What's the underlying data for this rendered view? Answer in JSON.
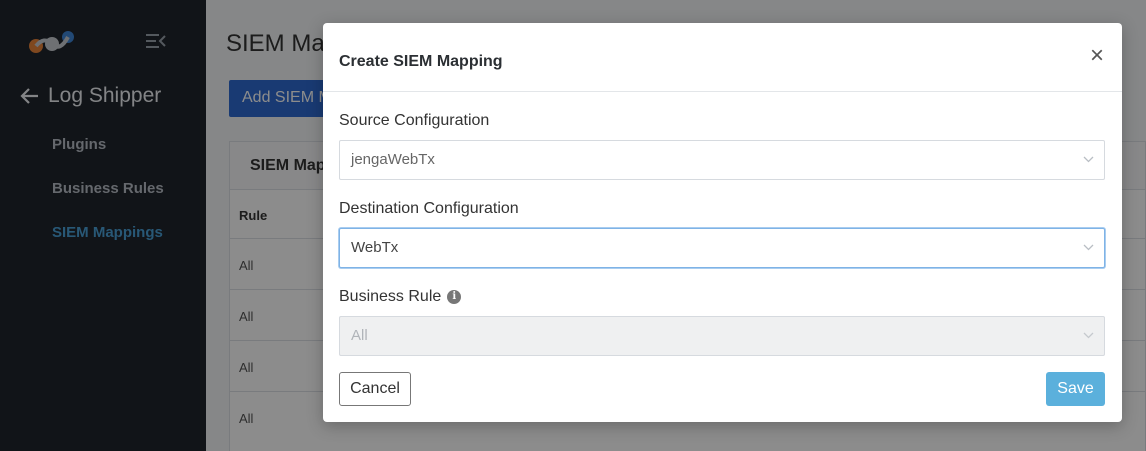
{
  "sidebar": {
    "back_label": "Log Shipper",
    "items": [
      {
        "label": "Plugins",
        "active": false
      },
      {
        "label": "Business Rules",
        "active": false
      },
      {
        "label": "SIEM Mappings",
        "active": true
      }
    ]
  },
  "main": {
    "title": "SIEM Map",
    "add_button": "Add SIEM M",
    "card_header": "SIEM Map",
    "column_rule": "Rule",
    "rows": [
      "All",
      "All",
      "All",
      "All"
    ]
  },
  "modal": {
    "title": "Create SIEM Mapping",
    "close": "×",
    "source_label": "Source Configuration",
    "source_value": "jengaWebTx",
    "destination_label": "Destination Configuration",
    "destination_value": "WebTx",
    "business_rule_label": "Business Rule",
    "info_icon": "i",
    "business_rule_value": "All",
    "cancel_label": "Cancel",
    "save_label": "Save"
  },
  "colors": {
    "sidebar_bg": "#1f252c",
    "accent": "#4aa0d8",
    "primary_button": "#2f6bd1",
    "save_button": "#5bb0dc"
  }
}
